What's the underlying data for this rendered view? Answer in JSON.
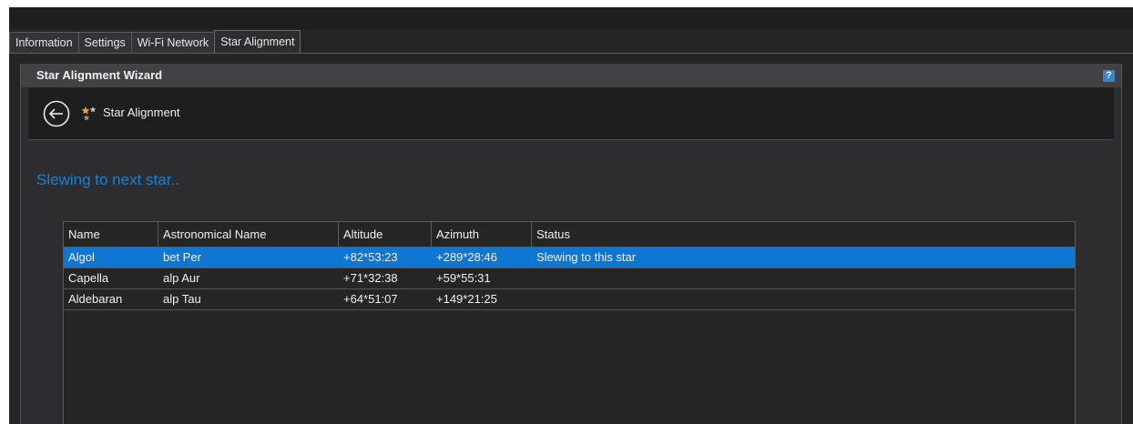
{
  "tabs": [
    {
      "label": "Information"
    },
    {
      "label": "Settings"
    },
    {
      "label": "Wi-Fi Network"
    },
    {
      "label": "Star Alignment",
      "active": true
    }
  ],
  "wizard": {
    "title": "Star Alignment Wizard",
    "help_icon": "?",
    "nav_title": "Star Alignment",
    "back_icon": "back-arrow-circle",
    "star_icon": "stars"
  },
  "status_text": "Slewing to next star..",
  "table": {
    "columns": [
      "Name",
      "Astronomical Name",
      "Altitude",
      "Azimuth",
      "Status"
    ],
    "rows": [
      {
        "name": "Algol",
        "astro": "bet Per",
        "alt": "+82*53:23",
        "az": "+289*28:46",
        "status": "Slewing to this star",
        "selected": true
      },
      {
        "name": "Capella",
        "astro": "alp Aur",
        "alt": "+71*32:38",
        "az": "+59*55:31",
        "status": ""
      },
      {
        "name": "Aldebaran",
        "astro": "alp Tau",
        "alt": "+64*51:07",
        "az": "+149*21:25",
        "status": ""
      }
    ]
  },
  "colors": {
    "background": "#252526",
    "header": "#424245",
    "accent": "#1e7fd0",
    "selection": "#0f77d3"
  }
}
